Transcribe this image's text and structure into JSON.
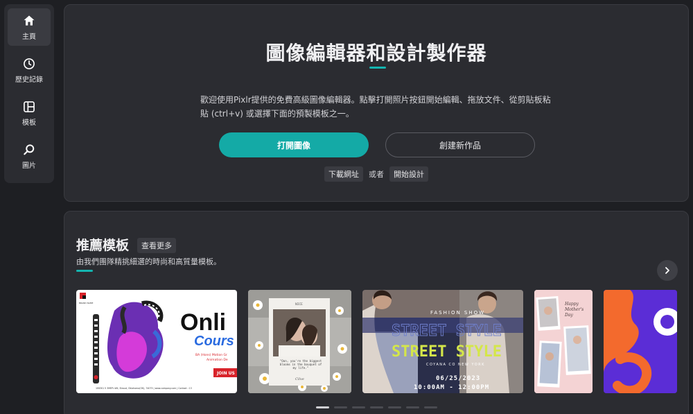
{
  "sidebar": {
    "items": [
      {
        "label": "主頁",
        "icon": "home-icon",
        "active": true
      },
      {
        "label": "歷史記錄",
        "icon": "clock-icon",
        "active": false
      },
      {
        "label": "模板",
        "icon": "template-icon",
        "active": false
      },
      {
        "label": "圖片",
        "icon": "search-icon",
        "active": false
      }
    ]
  },
  "hero": {
    "title": "圖像編輯器和設計製作器",
    "description": "歡迎使用Pixlr提供的免費高級圖像編輯器。點擊打開照片按鈕開始編輯、拖放文件、從剪貼板粘貼 (ctrl+v) 或選擇下面的預製模板之一。",
    "open_button": "打開圖像",
    "create_button": "創建新作品",
    "download_link": "下載網址",
    "or_text": "或者",
    "start_design_link": "開始設計"
  },
  "templates": {
    "title": "推薦模板",
    "see_more": "查看更多",
    "subtitle": "由我們團隊精挑細選的時尚和高質量模板。",
    "cards": [
      {
        "name": "online-course",
        "brand": "BRAND NAME",
        "headline": "Onli",
        "sub": "Cours",
        "caption": "BA (Hons) Motion Gr\nAnimation De",
        "cta": "JOIN US",
        "footer": "1E8301 5 3MEP=Wil, Stroud, Oklahoma(OK), 74075 | www.company.com | Contact : 13"
      },
      {
        "name": "floral-polaroid",
        "tag": "NICE",
        "quote": "\"Oon, you're the biggest blooms in the bouquet of my life.\"",
        "signature": "Cilve"
      },
      {
        "name": "street-style",
        "top": "FASHION SHOW",
        "headline": "STREET STYLE",
        "venue": "COYANA CO   NEW YORK",
        "date": "06/25/2023",
        "time": "10:00AM - 12:00PM"
      },
      {
        "name": "mothers-day-collage",
        "text": "Happy\nMother's\nDay"
      },
      {
        "name": "orange-purple-abstract"
      }
    ]
  },
  "pager": {
    "count": 7,
    "active": 0
  },
  "colors": {
    "accent": "#14aaa6",
    "panel": "#2b2c31",
    "background": "#1e1f23"
  }
}
